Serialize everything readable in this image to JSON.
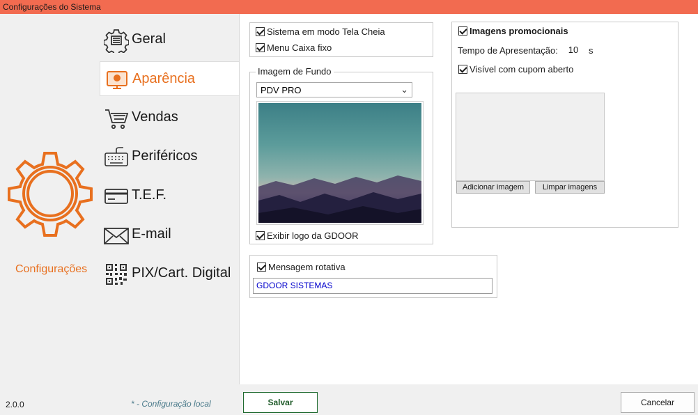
{
  "window": {
    "title": "Configurações do Sistema"
  },
  "sidebar": {
    "brand_label": "Configurações",
    "items": [
      {
        "label": "Geral",
        "icon": "gear-list-icon",
        "selected": false
      },
      {
        "label": "Aparência",
        "icon": "appearance-icon",
        "selected": true
      },
      {
        "label": "Vendas",
        "icon": "cart-icon",
        "selected": false
      },
      {
        "label": "Periféricos",
        "icon": "keyboard-icon",
        "selected": false
      },
      {
        "label": "T.E.F.",
        "icon": "card-icon",
        "selected": false
      },
      {
        "label": "E-mail",
        "icon": "envelope-icon",
        "selected": false
      },
      {
        "label": "PIX/Cart. Digital",
        "icon": "qr-code-icon",
        "selected": false
      }
    ]
  },
  "display": {
    "fullscreen_label": "Sistema em modo Tela Cheia",
    "fullscreen_checked": true,
    "fixed_menu_label": "Menu Caixa fixo",
    "fixed_menu_checked": true
  },
  "background": {
    "group_title": "Imagem de Fundo",
    "selected": "PDV PRO",
    "show_logo_label": "Exibir logo da GDOOR",
    "show_logo_checked": true
  },
  "rotating": {
    "label": "Mensagem rotativa",
    "checked": true,
    "value": "GDOOR SISTEMAS"
  },
  "promo": {
    "label": "Imagens promocionais",
    "checked": true,
    "time_label": "Tempo de Apresentação:",
    "time_value": "10",
    "time_unit": "s",
    "coupon_label": "Visível com cupom aberto",
    "coupon_checked": true,
    "add_button": "Adicionar imagem",
    "clear_button": "Limpar imagens"
  },
  "footer": {
    "version": "2.0.0",
    "note": "* - Configuração local",
    "save": "Salvar",
    "cancel": "Cancelar"
  },
  "colors": {
    "title_bar": "#f26b50",
    "accent_orange": "#e8701f",
    "save_border": "#1e6a2e",
    "input_text": "#0000cc"
  }
}
